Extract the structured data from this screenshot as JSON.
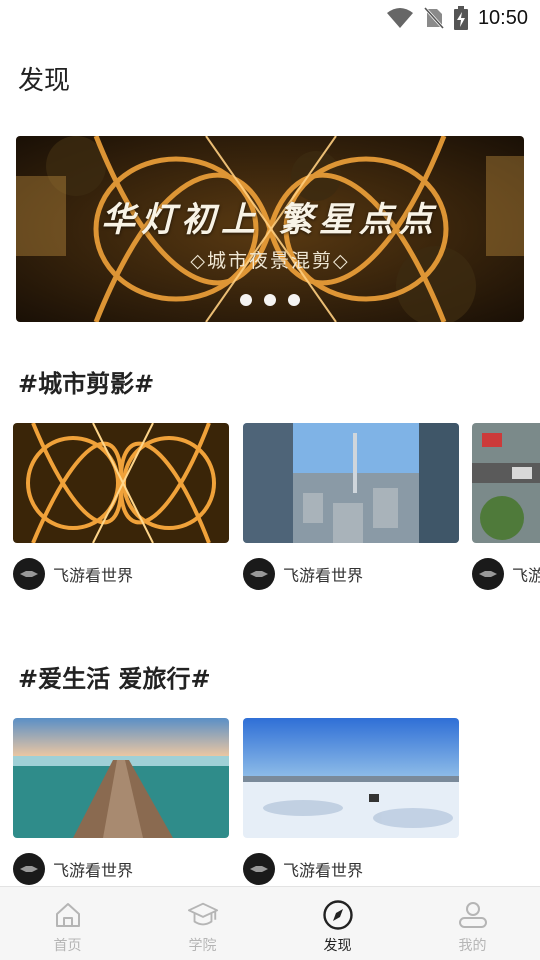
{
  "status_bar": {
    "time": "10:50",
    "icons": [
      "wifi-icon",
      "no-sim-icon",
      "battery-charging-icon"
    ]
  },
  "page": {
    "title": "发现"
  },
  "banner": {
    "title": "华灯初上 繁星点点",
    "subtitle": "◇城市夜景混剪◇",
    "dots": 3
  },
  "sections": [
    {
      "title": "#城市剪影#",
      "videos": [
        {
          "author": "飞游看世界",
          "thumb": "night-interchange"
        },
        {
          "author": "飞游看世界",
          "thumb": "canton-tower"
        },
        {
          "author": "飞游看世界",
          "thumb": "parking-lot"
        }
      ]
    },
    {
      "title": "#爱生活 爱旅行#",
      "videos": [
        {
          "author": "飞游看世界",
          "thumb": "frozen-causeway"
        },
        {
          "author": "飞游看世界",
          "thumb": "snow-field"
        }
      ]
    }
  ],
  "tab_bar": {
    "tabs": [
      {
        "label": "首页",
        "icon": "home-icon",
        "active": false
      },
      {
        "label": "学院",
        "icon": "graduation-cap-icon",
        "active": false
      },
      {
        "label": "发现",
        "icon": "compass-icon",
        "active": true
      },
      {
        "label": "我的",
        "icon": "profile-icon",
        "active": false
      }
    ]
  },
  "colors": {
    "active_tab": "#222222",
    "inactive_tab": "#b5b5b5",
    "tab_bar_bg": "#f6f6f6"
  }
}
